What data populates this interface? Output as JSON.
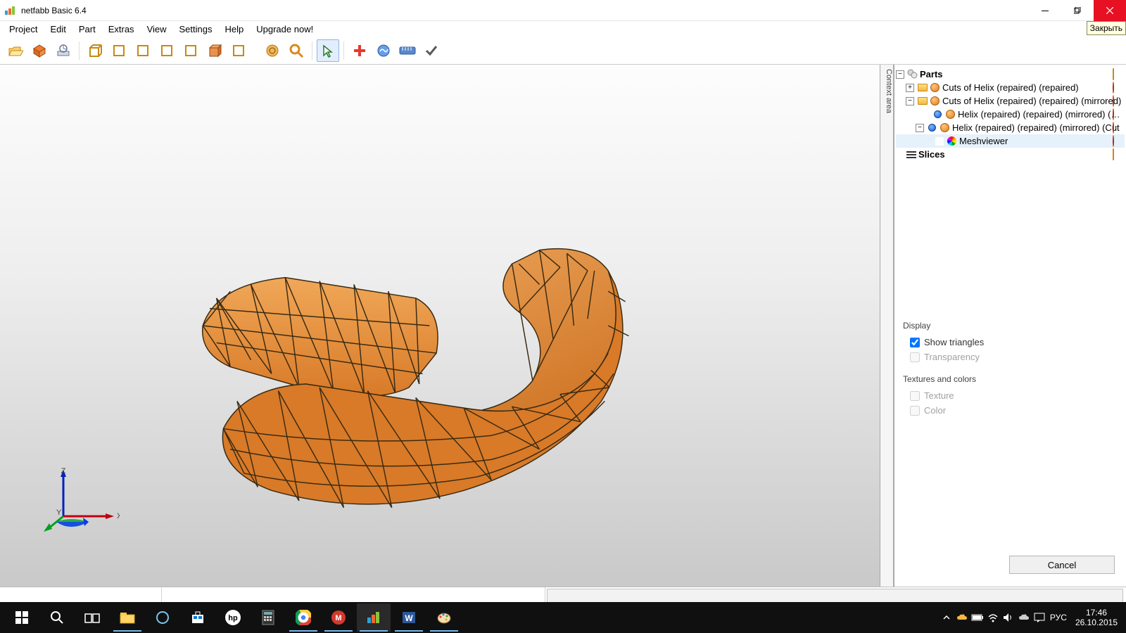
{
  "window": {
    "title": "netfabb Basic 6.4",
    "close_tooltip": "Закрыть"
  },
  "menu": {
    "project": "Project",
    "edit": "Edit",
    "part": "Part",
    "extras": "Extras",
    "view": "View",
    "settings": "Settings",
    "help": "Help",
    "upgrade": "Upgrade now!"
  },
  "context_label": "Context area",
  "tree": {
    "parts": "Parts",
    "cuts1": "Cuts of Helix (repaired) (repaired)",
    "cuts2": "Cuts of Helix (repaired) (repaired) (mirrored)",
    "helix1": "Helix (repaired) (repaired) (mirrored) (Cut",
    "helix2": "Helix (repaired) (repaired) (mirrored) (Cut",
    "meshviewer": "Meshviewer",
    "slices": "Slices"
  },
  "props": {
    "display_section": "Display",
    "show_triangles": "Show triangles",
    "transparency": "Transparency",
    "textures_section": "Textures and colors",
    "texture": "Texture",
    "color": "Color",
    "cancel": "Cancel"
  },
  "axes": {
    "x": "X",
    "y": "Y",
    "z": "Z"
  },
  "taskbar": {
    "lang": "РУС",
    "time": "17:46",
    "date": "26.10.2015"
  }
}
